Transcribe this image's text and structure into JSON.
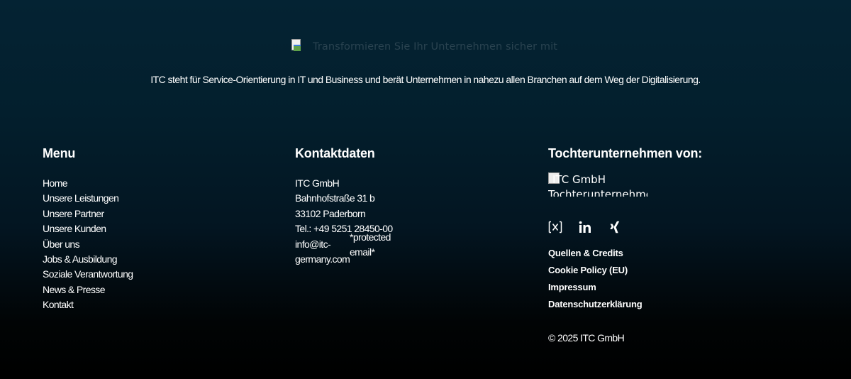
{
  "header": {
    "logo_alt": "Transformieren Sie Ihr Unternehmen sicher mit",
    "tagline": "ITC steht für Service-Orientierung in IT und Business und berät Unternehmen in nahezu allen Branchen auf dem Weg der Digitalisierung."
  },
  "menu": {
    "heading": "Menu",
    "items": [
      {
        "label": "Home"
      },
      {
        "label": "Unsere Leistungen"
      },
      {
        "label": "Unsere Partner"
      },
      {
        "label": "Unsere Kunden"
      },
      {
        "label": "Über uns"
      },
      {
        "label": "Jobs & Ausbildung"
      },
      {
        "label": "Soziale Verantwortung"
      },
      {
        "label": "News & Presse"
      },
      {
        "label": "Kontakt"
      }
    ]
  },
  "contact": {
    "heading": "Kontaktdaten",
    "company": "ITC GmbH",
    "street": "Bahnhofstraße 31 b",
    "city": "33102 Paderborn",
    "phone": "Tel.: +49 5251 28450-00",
    "email_prefix": "info@itc-germany.com",
    "email_protected": "*protected email*"
  },
  "subsidiary": {
    "heading": "Tochterunternehmen von:",
    "logo_alt": "ITC GmbH",
    "logo_alt_line2": "Tochterunternehmen",
    "socials": [
      {
        "name": "x-icon"
      },
      {
        "name": "linkedin-icon"
      },
      {
        "name": "xing-icon"
      }
    ],
    "legal_links": [
      {
        "label": "Quellen & Credits"
      },
      {
        "label": "Cookie Policy (EU)"
      },
      {
        "label": "Impressum"
      },
      {
        "label": "Datenschutzerklärung"
      }
    ],
    "copyright": "© 2025 ITC GmbH"
  },
  "colors": {
    "background_top": "#042333",
    "background_bottom": "#000000",
    "text": "#ffffff",
    "logo_alt_text": "#2a4350"
  }
}
